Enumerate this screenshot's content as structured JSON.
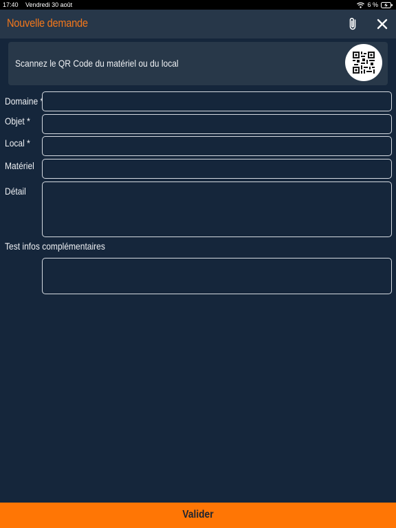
{
  "status_bar": {
    "time": "17:40",
    "date": "Vendredi 30 août",
    "battery": "6 %",
    "icons": [
      "wifi-icon",
      "battery-charging-icon"
    ]
  },
  "header": {
    "title": "Nouvelle demande",
    "title_color": "#f2771b",
    "icons": [
      "paperclip-icon",
      "close-icon"
    ]
  },
  "scan": {
    "text": "Scannez le QR Code du matériel ou du local",
    "icon": "qr-code-icon"
  },
  "form": {
    "domaine_label": "Domaine *",
    "domaine_value": "",
    "objet_label": "Objet *",
    "objet_value": "",
    "local_label": "Local *",
    "local_value": "",
    "materiel_label": "Matériel",
    "materiel_value": "",
    "detail_label": "Détail",
    "detail_value": "",
    "infos_label": "Test infos complémentaires",
    "infos_value": ""
  },
  "footer": {
    "validate_label": "Valider",
    "button_color": "#ff7605"
  },
  "colors": {
    "background": "#15263b",
    "header": "#273749",
    "accent": "#f2771b"
  }
}
